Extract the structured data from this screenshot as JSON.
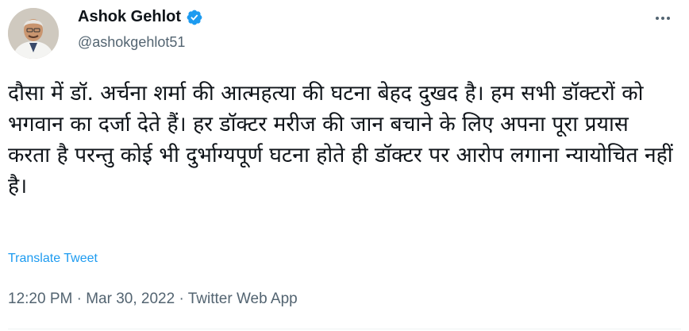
{
  "author": {
    "name": "Ashok Gehlot",
    "handle": "@ashokgehlot51",
    "verified": true,
    "avatar_icon": "profile-photo"
  },
  "menu_icon": "more-horizontal-icon",
  "tweet": {
    "text": "दौसा में डॉ. अर्चना शर्मा की आत्महत्या की घटना बेहद दुखद है। हम सभी डॉक्टरों को भगवान का दर्जा देते हैं। हर डॉक्टर मरीज की जान बचाने के लिए अपना पूरा प्रयास करता है परन्तु कोई भी दुर्भाग्यपूर्ण घटना होते ही डॉक्टर पर आरोप लगाना न्यायोचित नहीं है।",
    "translate_label": "Translate Tweet"
  },
  "meta": {
    "time": "12:20 PM",
    "separator": "·",
    "date": "Mar 30, 2022",
    "source": "Twitter Web App"
  },
  "colors": {
    "link": "#1d9bf0",
    "secondary_text": "#536471",
    "primary_text": "#0f1419",
    "verified": "#1d9bf0"
  }
}
